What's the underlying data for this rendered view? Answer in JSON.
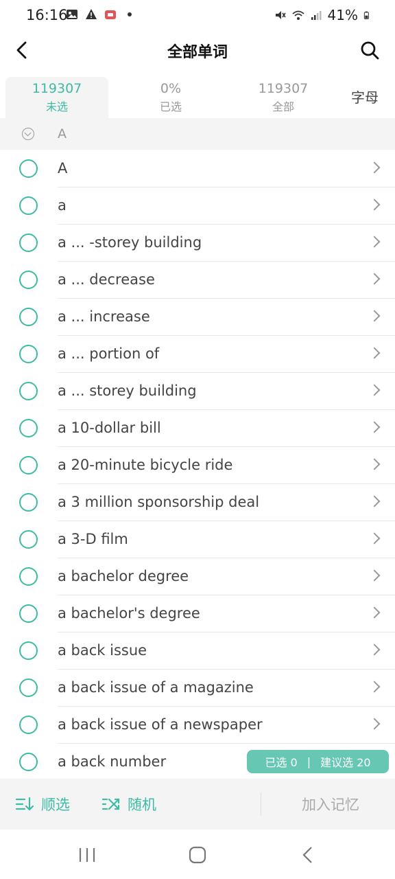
{
  "status_bar": {
    "time": "16:16",
    "battery": "41%",
    "icons_left": [
      "image-icon",
      "warning-icon",
      "app-notification-icon",
      "dot-icon"
    ],
    "icons_right": [
      "mute-icon",
      "wifi-icon",
      "signal-icon",
      "battery-icon"
    ]
  },
  "header": {
    "title": "全部单词"
  },
  "tabs": [
    {
      "number": "119307",
      "label": "未选",
      "active": true
    },
    {
      "number": "0%",
      "label": "已选",
      "active": false
    },
    {
      "number": "119307",
      "label": "全部",
      "active": false
    }
  ],
  "tab_letter": "字母",
  "section": {
    "label": "A"
  },
  "words": [
    "A",
    "a",
    "a ... -storey building",
    "a ... decrease",
    "a ... increase",
    "a ... portion of",
    "a ... storey building",
    "a 10-dollar bill",
    "a 20-minute bicycle ride",
    "a 3 million sponsorship deal",
    "a 3-D film",
    "a bachelor degree",
    "a bachelor's degree",
    "a back issue",
    "a back issue of a magazine",
    "a back issue of a newspaper",
    "a back number"
  ],
  "pill": {
    "selected": "已选 0",
    "separator": "|",
    "suggest": "建议选 20"
  },
  "toolbar": {
    "sequential": "顺选",
    "random": "随机",
    "add_memory": "加入记忆"
  },
  "colors": {
    "accent": "#3dbba4",
    "pill": "#66c7b3",
    "muted": "#999999"
  }
}
